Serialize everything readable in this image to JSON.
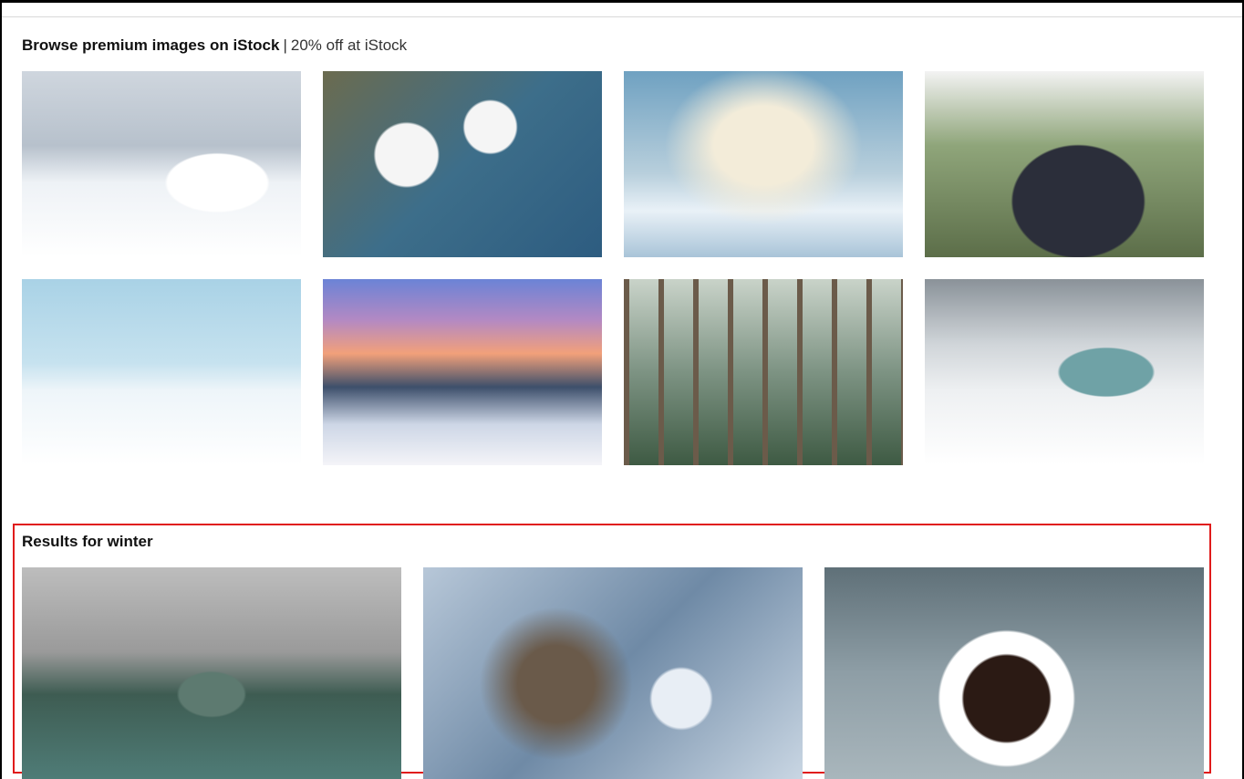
{
  "browse": {
    "title": "Browse premium images on iStock",
    "separator": "|",
    "promo": "20% off at iStock",
    "images": [
      {
        "name": "snowman-house"
      },
      {
        "name": "marshmallow-snowmen-cocoa"
      },
      {
        "name": "winter-bokeh-snow"
      },
      {
        "name": "family-winter-portrait"
      },
      {
        "name": "snowy-background"
      },
      {
        "name": "mountain-sunset-snow"
      },
      {
        "name": "forest-path"
      },
      {
        "name": "fat-bike-snow-lake"
      }
    ]
  },
  "results": {
    "title": "Results for winter",
    "images": [
      {
        "name": "woman-canoe-misty-lake"
      },
      {
        "name": "snowflake-closeup"
      },
      {
        "name": "hot-coffee-mittens"
      }
    ]
  },
  "colors": {
    "highlight_border": "#e01b1b"
  }
}
